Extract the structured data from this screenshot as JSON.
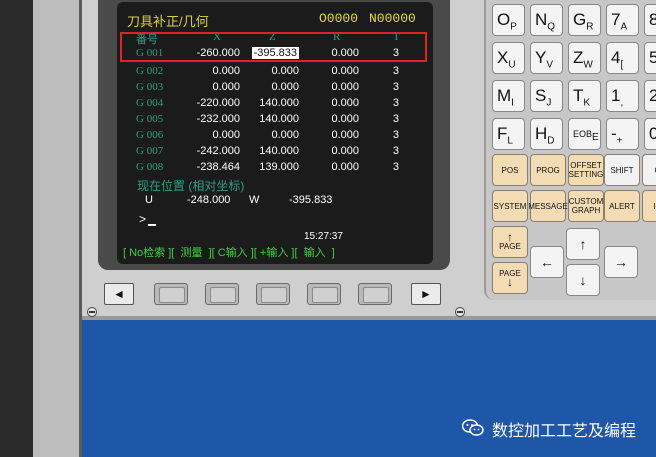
{
  "screen": {
    "title": "刀具补正/几何",
    "program": "O0000",
    "sequence": "N00000",
    "columns": [
      "番号",
      "X",
      "Z",
      "R",
      "T"
    ],
    "rows": [
      {
        "no": "G 001",
        "x": "-260.000",
        "z": "-395.833",
        "r": "0.000",
        "t": "3"
      },
      {
        "no": "G 002",
        "x": "0.000",
        "z": "0.000",
        "r": "0.000",
        "t": "3"
      },
      {
        "no": "G 003",
        "x": "0.000",
        "z": "0.000",
        "r": "0.000",
        "t": "3"
      },
      {
        "no": "G 004",
        "x": "-220.000",
        "z": "140.000",
        "r": "0.000",
        "t": "3"
      },
      {
        "no": "G 005",
        "x": "-232.000",
        "z": "140.000",
        "r": "0.000",
        "t": "3"
      },
      {
        "no": "G 006",
        "x": "0.000",
        "z": "0.000",
        "r": "0.000",
        "t": "3"
      },
      {
        "no": "G 007",
        "x": "-242.000",
        "z": "140.000",
        "r": "0.000",
        "t": "3"
      },
      {
        "no": "G 008",
        "x": "-238.464",
        "z": "139.000",
        "r": "0.000",
        "t": "3"
      }
    ],
    "position_title": "现在位置 (相对坐标)",
    "u_label": "U",
    "u_value": "-248.000",
    "w_label": "W",
    "w_value": "-395.833",
    "prompt": ">",
    "clock": "15:27:37",
    "softkeys": "[ No检索 ][  测量  ][ C输入 ][ +输入 ][  输入  ]"
  },
  "softkey_buttons": {
    "left_arrow": "◄",
    "right_arrow": "►"
  },
  "keypad": {
    "row1": [
      {
        "main": "O",
        "sub": "P"
      },
      {
        "main": "N",
        "sub": "Q"
      },
      {
        "main": "G",
        "sub": "R"
      },
      {
        "main": "7",
        "sub": "A"
      },
      {
        "main": "8",
        "sub": ""
      }
    ],
    "row2": [
      {
        "main": "X",
        "sub": "U"
      },
      {
        "main": "Y",
        "sub": "V"
      },
      {
        "main": "Z",
        "sub": "W"
      },
      {
        "main": "4",
        "sub": "["
      },
      {
        "main": "5",
        "sub": ""
      }
    ],
    "row3": [
      {
        "main": "M",
        "sub": "I"
      },
      {
        "main": "S",
        "sub": "J"
      },
      {
        "main": "T",
        "sub": "K"
      },
      {
        "main": "1",
        "sub": ","
      },
      {
        "main": "2",
        "sub": ""
      }
    ],
    "row4": [
      {
        "main": "F",
        "sub": "L"
      },
      {
        "main": "H",
        "sub": "D"
      },
      {
        "main": "EOB",
        "sub": "E"
      },
      {
        "main": "-",
        "sub": "+"
      },
      {
        "main": "0",
        "sub": ""
      }
    ],
    "func_row1": [
      "POS",
      "PROG",
      "OFFSET SETTING",
      "SHIFT",
      "CA"
    ],
    "func_row2": [
      "SYSTEM",
      "MESSAGE",
      "CUSTOM GRAPH",
      "ALERT",
      "INS"
    ],
    "page_up": "PAGE",
    "page_down": "PAGE",
    "arrow_up": "↑",
    "arrow_down": "↓",
    "arrow_left": "←",
    "arrow_right": "→"
  },
  "watermark": "数控加工工艺及编程"
}
